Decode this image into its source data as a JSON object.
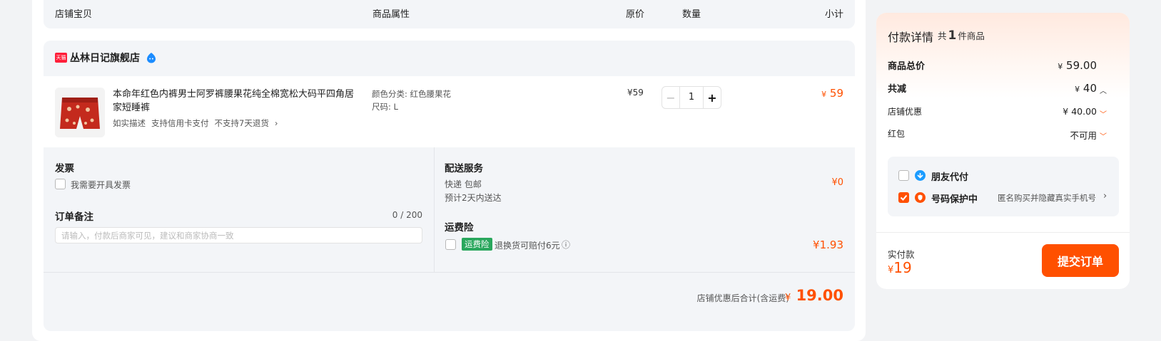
{
  "header": {
    "col_item": "店铺宝贝",
    "col_attrs": "商品属性",
    "col_price": "原价",
    "col_qty": "数量",
    "col_subtotal": "小计"
  },
  "shop": {
    "badge": "天猫",
    "name": "丛林日记旗舰店",
    "brand_color": "#ff1f3a"
  },
  "item": {
    "title": "本命年红色内裤男士阿罗裤腰果花纯全棉宽松大码平四角居家短睡裤",
    "tags": [
      "如实描述",
      "支持信用卡支付",
      "不支持7天退货"
    ],
    "tag_more": "›",
    "attr_color": "颜色分类: 红色腰果花",
    "attr_size": "尺码: L",
    "unit_price": "¥59",
    "quantity": "1",
    "minus": "−",
    "plus": "+",
    "subtotal_symbol": "¥",
    "subtotal_value": "59"
  },
  "invoice": {
    "title": "发票",
    "checkbox_label": "我需要开具发票"
  },
  "remark": {
    "title": "订单备注",
    "counter": "0 / 200",
    "placeholder": "请输入，付款后商家可见，建议和商家协商一致",
    "value": ""
  },
  "delivery": {
    "title": "配送服务",
    "method": "快递 包邮",
    "eta": "预计2天内送达",
    "price": "¥0"
  },
  "insurance": {
    "title": "运费险",
    "badge": "运费险",
    "desc": "退换货可赔付6元",
    "info_icon": "ⓘ",
    "price": "¥1.93",
    "badge_color": "#2aa75d"
  },
  "order_total": {
    "label": "店铺优惠后合计(含运费)",
    "symbol": "¥",
    "value": "19.00"
  },
  "payment": {
    "title": "付款详情",
    "count_prefix": "共",
    "count": "1",
    "count_suffix": "件商品",
    "goods_total_label": "商品总价",
    "goods_total_symbol": "¥",
    "goods_total_value": "59.00",
    "discount_label": "共减",
    "discount_symbol": "¥",
    "discount_value": "40",
    "shop_discount_label": "店铺优惠",
    "shop_discount_value": "¥ 40.00",
    "redpacket_label": "红包",
    "redpacket_value": "不可用",
    "friend_pay_label": "朋友代付",
    "privacy_label": "号码保护中",
    "privacy_desc": "匿名购买并隐藏真实手机号",
    "paid_label": "实付款",
    "paid_symbol": "¥",
    "paid_value": "19",
    "submit_label": "提交订单",
    "accent_color": "#ff5000"
  }
}
